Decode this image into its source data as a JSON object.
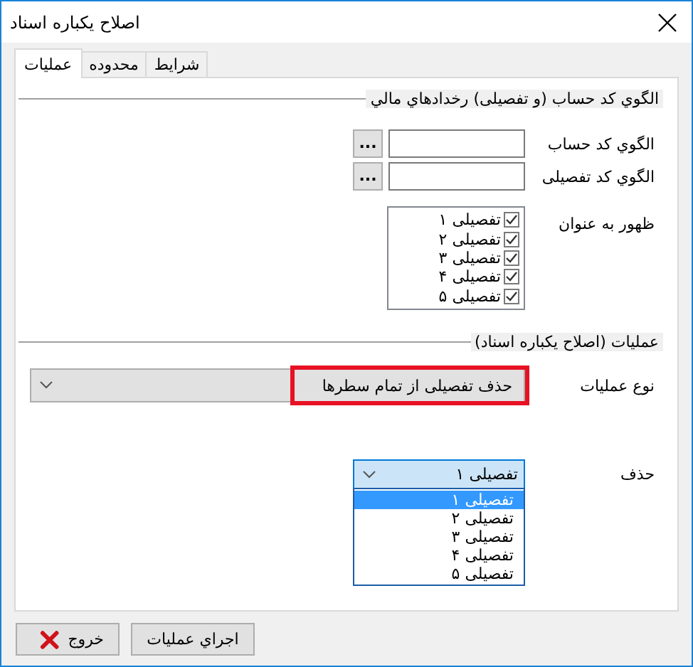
{
  "window": {
    "title": "اصلاح يکباره اسناد"
  },
  "tabs": [
    {
      "label": "شرایط",
      "selected": false
    },
    {
      "label": "محدوده",
      "selected": false
    },
    {
      "label": "عملیات",
      "selected": true
    }
  ],
  "pattern_group": {
    "title": "الگوي کد حساب (و تفصیلی) رخدادهاي مالي",
    "fields": [
      {
        "label": "الگوي کد حساب",
        "button": "..."
      },
      {
        "label": "الگوي کد تفصیلی",
        "button": "..."
      }
    ],
    "display_as": {
      "label": "ظهور به عنوان",
      "items": [
        {
          "label": "تفصیلی ۱",
          "checked": true
        },
        {
          "label": "تفصیلی ۲",
          "checked": true
        },
        {
          "label": "تفصیلی ۳",
          "checked": true
        },
        {
          "label": "تفصیلی ۴",
          "checked": true
        },
        {
          "label": "تفصیلی ۵",
          "checked": true
        }
      ]
    }
  },
  "operations_group": {
    "title": "عملیات (اصلاح يکباره اسناد)",
    "operation_type": {
      "label": "نوع عملیات",
      "value": "حذف تفصیلی از تمام سطرها",
      "highlighted": true
    },
    "delete": {
      "label": "حذف",
      "value": "تفصیلی ۱",
      "expanded": true,
      "options": [
        {
          "label": "تفصیلی ۱",
          "selected": true
        },
        {
          "label": "تفصیلی ۲",
          "selected": false
        },
        {
          "label": "تفصیلی ۳",
          "selected": false
        },
        {
          "label": "تفصیلی ۴",
          "selected": false
        },
        {
          "label": "تفصیلی ۵",
          "selected": false
        }
      ]
    }
  },
  "buttons": [
    {
      "label": "اجراي عملیات",
      "kind": "run"
    },
    {
      "label": "خروج",
      "kind": "exit"
    }
  ]
}
